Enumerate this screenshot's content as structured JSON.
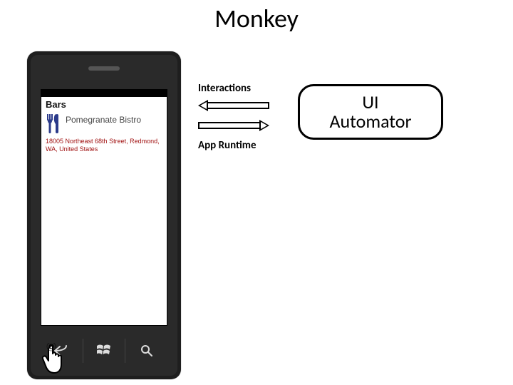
{
  "title": "Monkey",
  "labels": {
    "interactions": "Interactions",
    "app_runtime": "App Runtime"
  },
  "uia_box": "UI\nAutomator",
  "phone": {
    "header": "Bars",
    "listing_name": "Pomegranate Bistro",
    "address": "18005 Northeast 68th Street, Redmond, WA, United States"
  }
}
